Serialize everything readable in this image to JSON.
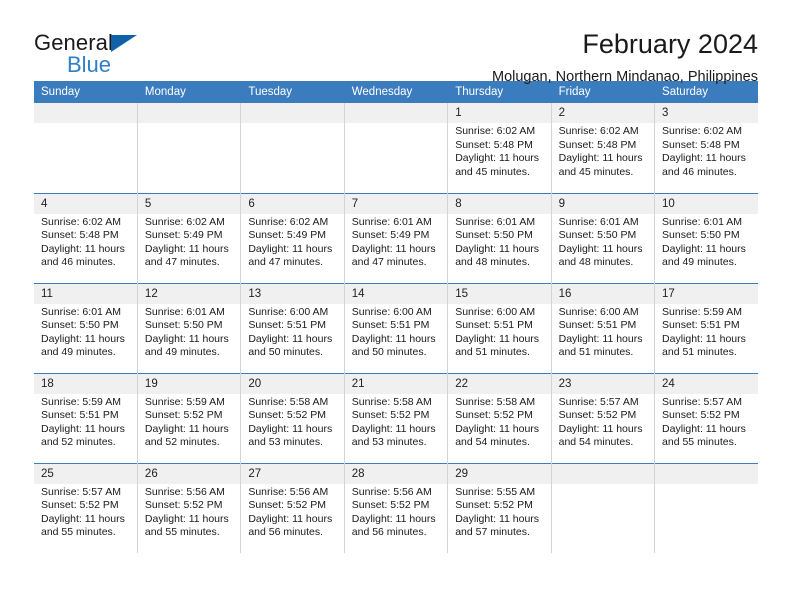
{
  "brand": {
    "line1": "General",
    "line2": "Blue",
    "triangle_icon": "triangle-icon",
    "accent_color": "#2f7fc6",
    "triangle_color": "#0f62a8"
  },
  "header": {
    "month_title": "February 2024",
    "location": "Molugan, Northern Mindanao, Philippines",
    "header_bg_color": "#3b7cbe",
    "daynum_bg_color": "#f0f0f0"
  },
  "weekday_headers": [
    "Sunday",
    "Monday",
    "Tuesday",
    "Wednesday",
    "Thursday",
    "Friday",
    "Saturday"
  ],
  "labels": {
    "sunrise_prefix": "Sunrise:",
    "sunset_prefix": "Sunset:",
    "daylight_prefix": "Daylight:"
  },
  "weeks": [
    [
      {
        "day": "",
        "empty": true
      },
      {
        "day": "",
        "empty": true
      },
      {
        "day": "",
        "empty": true
      },
      {
        "day": "",
        "empty": true
      },
      {
        "day": "1",
        "sunrise": "Sunrise: 6:02 AM",
        "sunset": "Sunset: 5:48 PM",
        "daylight_l1": "Daylight: 11 hours",
        "daylight_l2": "and 45 minutes."
      },
      {
        "day": "2",
        "sunrise": "Sunrise: 6:02 AM",
        "sunset": "Sunset: 5:48 PM",
        "daylight_l1": "Daylight: 11 hours",
        "daylight_l2": "and 45 minutes."
      },
      {
        "day": "3",
        "sunrise": "Sunrise: 6:02 AM",
        "sunset": "Sunset: 5:48 PM",
        "daylight_l1": "Daylight: 11 hours",
        "daylight_l2": "and 46 minutes."
      }
    ],
    [
      {
        "day": "4",
        "sunrise": "Sunrise: 6:02 AM",
        "sunset": "Sunset: 5:48 PM",
        "daylight_l1": "Daylight: 11 hours",
        "daylight_l2": "and 46 minutes."
      },
      {
        "day": "5",
        "sunrise": "Sunrise: 6:02 AM",
        "sunset": "Sunset: 5:49 PM",
        "daylight_l1": "Daylight: 11 hours",
        "daylight_l2": "and 47 minutes."
      },
      {
        "day": "6",
        "sunrise": "Sunrise: 6:02 AM",
        "sunset": "Sunset: 5:49 PM",
        "daylight_l1": "Daylight: 11 hours",
        "daylight_l2": "and 47 minutes."
      },
      {
        "day": "7",
        "sunrise": "Sunrise: 6:01 AM",
        "sunset": "Sunset: 5:49 PM",
        "daylight_l1": "Daylight: 11 hours",
        "daylight_l2": "and 47 minutes."
      },
      {
        "day": "8",
        "sunrise": "Sunrise: 6:01 AM",
        "sunset": "Sunset: 5:50 PM",
        "daylight_l1": "Daylight: 11 hours",
        "daylight_l2": "and 48 minutes."
      },
      {
        "day": "9",
        "sunrise": "Sunrise: 6:01 AM",
        "sunset": "Sunset: 5:50 PM",
        "daylight_l1": "Daylight: 11 hours",
        "daylight_l2": "and 48 minutes."
      },
      {
        "day": "10",
        "sunrise": "Sunrise: 6:01 AM",
        "sunset": "Sunset: 5:50 PM",
        "daylight_l1": "Daylight: 11 hours",
        "daylight_l2": "and 49 minutes."
      }
    ],
    [
      {
        "day": "11",
        "sunrise": "Sunrise: 6:01 AM",
        "sunset": "Sunset: 5:50 PM",
        "daylight_l1": "Daylight: 11 hours",
        "daylight_l2": "and 49 minutes."
      },
      {
        "day": "12",
        "sunrise": "Sunrise: 6:01 AM",
        "sunset": "Sunset: 5:50 PM",
        "daylight_l1": "Daylight: 11 hours",
        "daylight_l2": "and 49 minutes."
      },
      {
        "day": "13",
        "sunrise": "Sunrise: 6:00 AM",
        "sunset": "Sunset: 5:51 PM",
        "daylight_l1": "Daylight: 11 hours",
        "daylight_l2": "and 50 minutes."
      },
      {
        "day": "14",
        "sunrise": "Sunrise: 6:00 AM",
        "sunset": "Sunset: 5:51 PM",
        "daylight_l1": "Daylight: 11 hours",
        "daylight_l2": "and 50 minutes."
      },
      {
        "day": "15",
        "sunrise": "Sunrise: 6:00 AM",
        "sunset": "Sunset: 5:51 PM",
        "daylight_l1": "Daylight: 11 hours",
        "daylight_l2": "and 51 minutes."
      },
      {
        "day": "16",
        "sunrise": "Sunrise: 6:00 AM",
        "sunset": "Sunset: 5:51 PM",
        "daylight_l1": "Daylight: 11 hours",
        "daylight_l2": "and 51 minutes."
      },
      {
        "day": "17",
        "sunrise": "Sunrise: 5:59 AM",
        "sunset": "Sunset: 5:51 PM",
        "daylight_l1": "Daylight: 11 hours",
        "daylight_l2": "and 51 minutes."
      }
    ],
    [
      {
        "day": "18",
        "sunrise": "Sunrise: 5:59 AM",
        "sunset": "Sunset: 5:51 PM",
        "daylight_l1": "Daylight: 11 hours",
        "daylight_l2": "and 52 minutes."
      },
      {
        "day": "19",
        "sunrise": "Sunrise: 5:59 AM",
        "sunset": "Sunset: 5:52 PM",
        "daylight_l1": "Daylight: 11 hours",
        "daylight_l2": "and 52 minutes."
      },
      {
        "day": "20",
        "sunrise": "Sunrise: 5:58 AM",
        "sunset": "Sunset: 5:52 PM",
        "daylight_l1": "Daylight: 11 hours",
        "daylight_l2": "and 53 minutes."
      },
      {
        "day": "21",
        "sunrise": "Sunrise: 5:58 AM",
        "sunset": "Sunset: 5:52 PM",
        "daylight_l1": "Daylight: 11 hours",
        "daylight_l2": "and 53 minutes."
      },
      {
        "day": "22",
        "sunrise": "Sunrise: 5:58 AM",
        "sunset": "Sunset: 5:52 PM",
        "daylight_l1": "Daylight: 11 hours",
        "daylight_l2": "and 54 minutes."
      },
      {
        "day": "23",
        "sunrise": "Sunrise: 5:57 AM",
        "sunset": "Sunset: 5:52 PM",
        "daylight_l1": "Daylight: 11 hours",
        "daylight_l2": "and 54 minutes."
      },
      {
        "day": "24",
        "sunrise": "Sunrise: 5:57 AM",
        "sunset": "Sunset: 5:52 PM",
        "daylight_l1": "Daylight: 11 hours",
        "daylight_l2": "and 55 minutes."
      }
    ],
    [
      {
        "day": "25",
        "sunrise": "Sunrise: 5:57 AM",
        "sunset": "Sunset: 5:52 PM",
        "daylight_l1": "Daylight: 11 hours",
        "daylight_l2": "and 55 minutes."
      },
      {
        "day": "26",
        "sunrise": "Sunrise: 5:56 AM",
        "sunset": "Sunset: 5:52 PM",
        "daylight_l1": "Daylight: 11 hours",
        "daylight_l2": "and 55 minutes."
      },
      {
        "day": "27",
        "sunrise": "Sunrise: 5:56 AM",
        "sunset": "Sunset: 5:52 PM",
        "daylight_l1": "Daylight: 11 hours",
        "daylight_l2": "and 56 minutes."
      },
      {
        "day": "28",
        "sunrise": "Sunrise: 5:56 AM",
        "sunset": "Sunset: 5:52 PM",
        "daylight_l1": "Daylight: 11 hours",
        "daylight_l2": "and 56 minutes."
      },
      {
        "day": "29",
        "sunrise": "Sunrise: 5:55 AM",
        "sunset": "Sunset: 5:52 PM",
        "daylight_l1": "Daylight: 11 hours",
        "daylight_l2": "and 57 minutes."
      },
      {
        "day": "",
        "empty": true
      },
      {
        "day": "",
        "empty": true
      }
    ]
  ]
}
